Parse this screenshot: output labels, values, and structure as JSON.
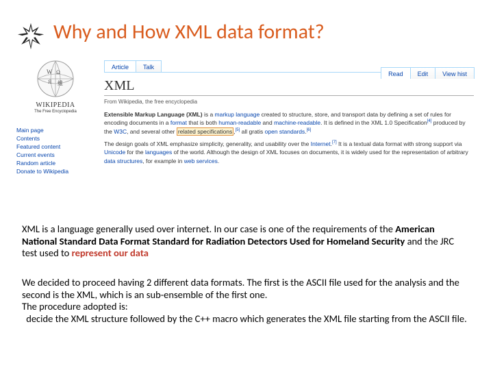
{
  "title": "Why and How XML data format?",
  "wiki": {
    "logo_text": "WIKIPEDIA",
    "logo_sub": "The Free Encyclopedia",
    "tabs_left": [
      "Article",
      "Talk"
    ],
    "tabs_right": [
      "Read",
      "Edit",
      "View hist"
    ],
    "nav": [
      "Main page",
      "Contents",
      "Featured content",
      "Current events",
      "Random article",
      "Donate to Wikipedia"
    ],
    "heading": "XML",
    "subline": "From Wikipedia, the free encyclopedia",
    "p1_a": "Extensible Markup Language (XML)",
    "p1_b": " is a ",
    "p1_c": "markup language",
    "p1_d": " created to structure, store, and transport data by defining a set of rules for encoding documents in a ",
    "p1_e": "format",
    "p1_f": " that is both ",
    "p1_g": "human-readable",
    "p1_h": " and ",
    "p1_i": "machine-readable",
    "p1_j": ". It is defined in the XML 1.0 Specification",
    "p1_k": " produced by the ",
    "p1_l": "W3C",
    "p1_m": ", and several other ",
    "p1_n": "related specifications",
    "p1_o": ",",
    "p1_p": " all gratis ",
    "p1_q": "open standards",
    "p1_r": ".",
    "p2_a": "The design goals of XML emphasize simplicity, generality, and usability over the ",
    "p2_b": "Internet",
    "p2_c": ".",
    "p2_d": " It is a textual data format with strong support via ",
    "p2_e": "Unicode",
    "p2_f": " for the ",
    "p2_g": "languages",
    "p2_h": " of the world. Although the design of XML focuses on documents, it is widely used for the representation of arbitrary ",
    "p2_i": "data structures",
    "p2_j": ", for example in ",
    "p2_k": "web services",
    "p2_l": ".",
    "sup4": "[4]",
    "sup5": "[5]",
    "sup6": "[6]",
    "sup7": "[7]"
  },
  "para1_a": "XML is a language generally used over internet. In our case is one of the requirements of the ",
  "para1_b": "American National Standard Data Format Standard for Radiation Detectors Used for Homeland Security",
  "para1_c": " and the JRC test used to ",
  "para1_d": "represent our data",
  "para2_a": "We decided to proceed  having 2 different data formats. The first is the ASCII file used for the analysis and the second is the XML, which is an sub-ensemble of the first one.",
  "para2_b": "The procedure adopted is:",
  "para2_c": "decide the XML structure followed by the C++ macro which generates the XML file starting from the ASCII file."
}
